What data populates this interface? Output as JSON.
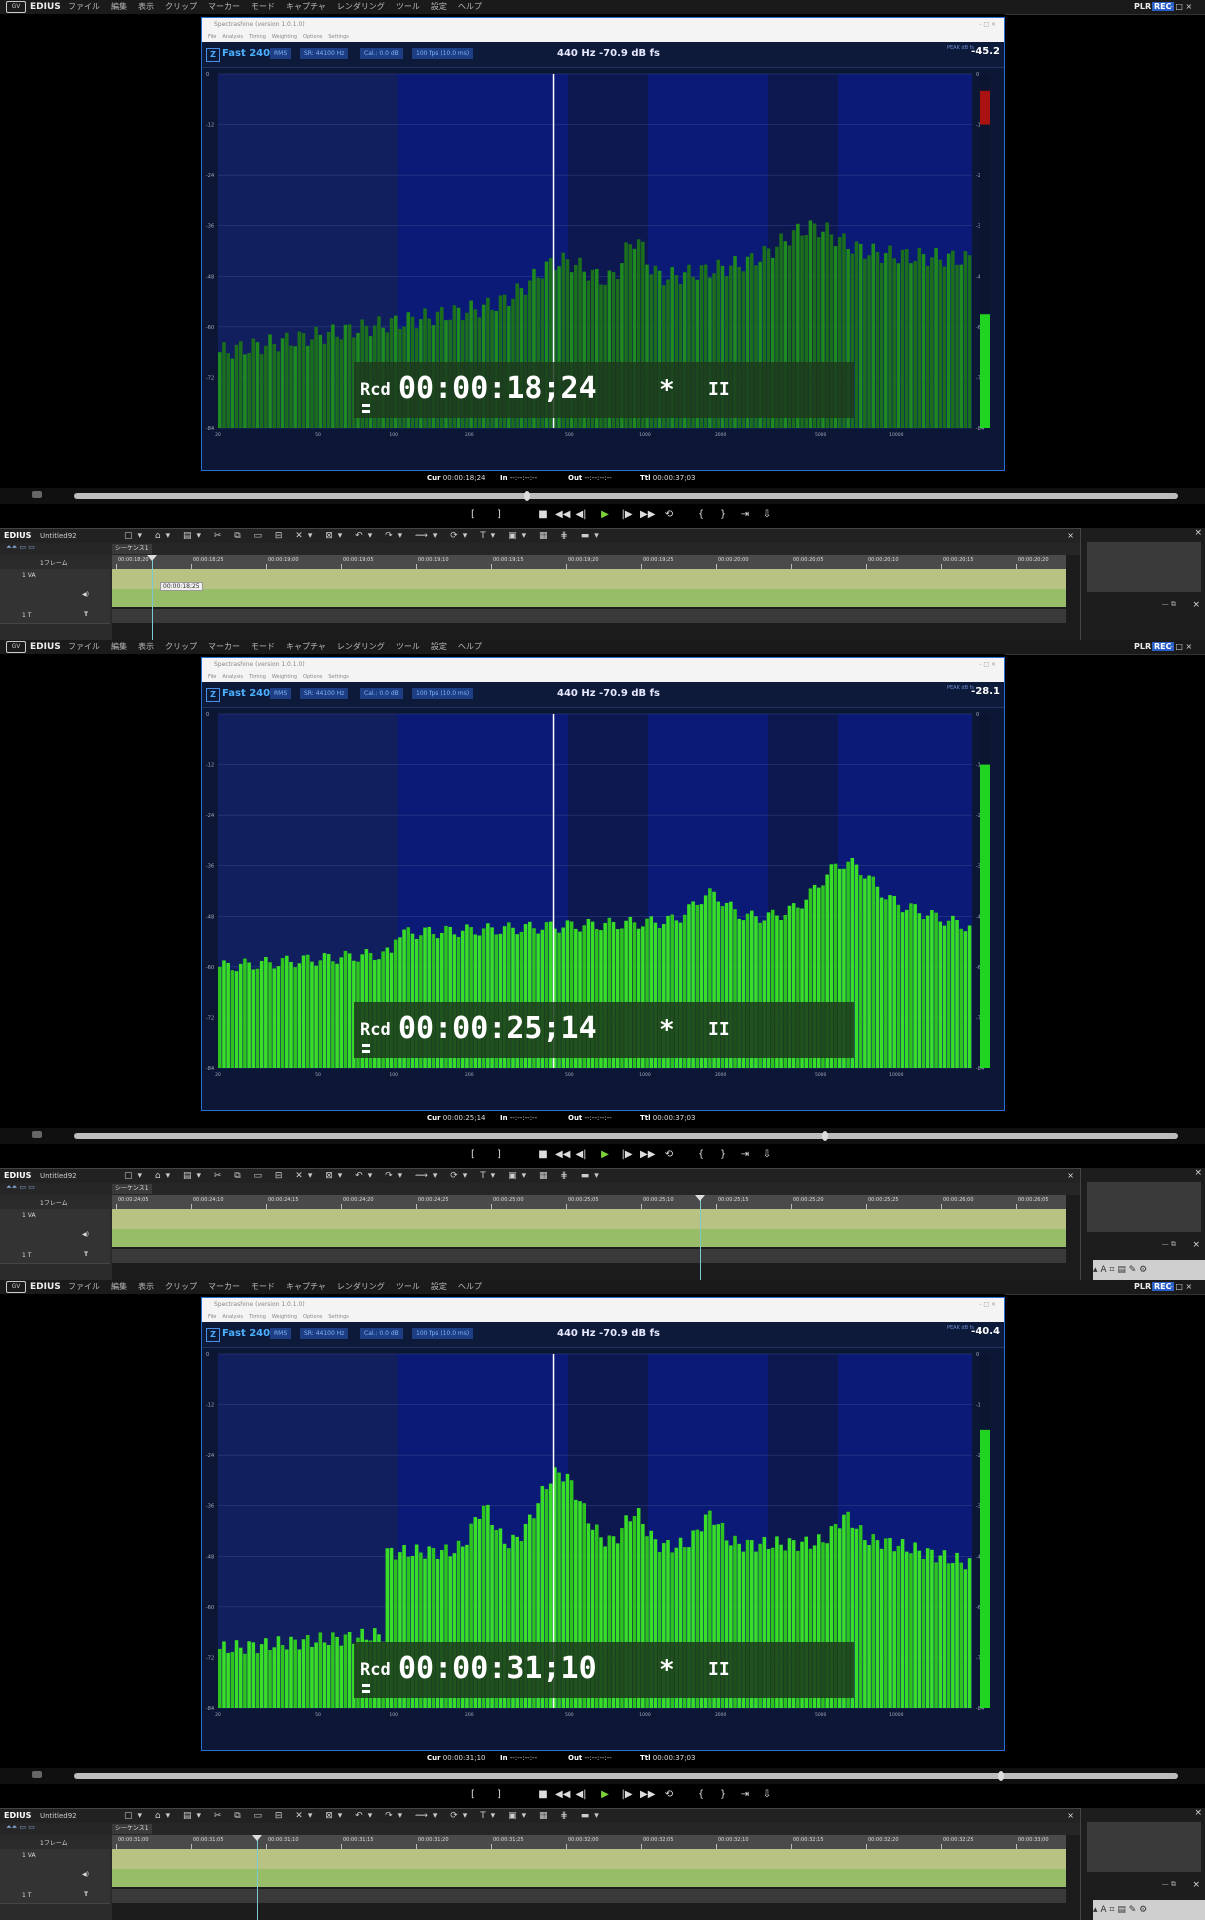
{
  "app": {
    "name": "EDIUS",
    "logo": "GV",
    "menus": [
      "ファイル",
      "編集",
      "表示",
      "クリップ",
      "マーカー",
      "モード",
      "キャプチャ",
      "レンダリング",
      "ツール",
      "設定",
      "ヘルプ"
    ],
    "mode": "PLR",
    "rec": "REC",
    "window_controls": "- □ ×"
  },
  "plugin": {
    "title": "Spectrashine (version 1.0.1.0)",
    "menu": [
      "File",
      "Analysis",
      "Timing",
      "Weighting",
      "Options",
      "Settings"
    ],
    "mode_label": "Fast 240",
    "mode_icon": "Z",
    "chips": [
      "RMS",
      "SR: 44100 Hz",
      "Cal.: 0.0 dB",
      "100 fps (10.0 ms)"
    ],
    "freq_readout": "440 Hz  -70.9 dB fs",
    "peak_label": "PEAK dB fs",
    "y_ticks": [
      "0",
      "-12",
      "-24",
      "-36",
      "-48",
      "-60",
      "-72",
      "-84"
    ],
    "x_ticks": [
      "20",
      "50",
      "100",
      "200",
      "500",
      "1000",
      "2000",
      "5000",
      "10000"
    ],
    "title_buttons": "- □ ×"
  },
  "frames": [
    {
      "timecode": "00:00:18;24",
      "rcd": "Rcd",
      "star": "*",
      "pause": "II",
      "peak": "-45.2",
      "cur": "00:00:18;24",
      "in": "--:--:--:--",
      "out": "--:--:--:--",
      "ttl": "00:00:37;03",
      "seek_fraction": 0.41,
      "timeline_tooltip": "00:00:18;25",
      "ruler": [
        "00:00:18;20",
        "00:00:18;25",
        "00:00:19;00",
        "00:00:19;05",
        "00:00:19;10",
        "00:00:19;15",
        "00:00:19;20",
        "00:00:19;25",
        "00:00:20;00",
        "00:00:20;05",
        "00:00:20;10",
        "00:00:20;15",
        "00:00:20;20"
      ]
    },
    {
      "timecode": "00:00:25;14",
      "rcd": "Rcd",
      "star": "*",
      "pause": "II",
      "peak": "-28.1",
      "cur": "00:00:25;14",
      "in": "--:--:--:--",
      "out": "--:--:--:--",
      "ttl": "00:00:37;03",
      "seek_fraction": 0.68,
      "timeline_tooltip": "",
      "ruler": [
        "00:00:24;05",
        "00:00:24;10",
        "00:00:24;15",
        "00:00:24;20",
        "00:00:24;25",
        "00:00:25;00",
        "00:00:25;05",
        "00:00:25;10",
        "00:00:25;15",
        "00:00:25;20",
        "00:00:25;25",
        "00:00:26;00",
        "00:00:26;05"
      ]
    },
    {
      "timecode": "00:00:31;10",
      "rcd": "Rcd",
      "star": "*",
      "pause": "II",
      "peak": "-40.4",
      "cur": "00:00:31;10",
      "in": "--:--:--:--",
      "out": "--:--:--:--",
      "ttl": "00:00:37;03",
      "seek_fraction": 0.84,
      "timeline_tooltip": "",
      "ruler": [
        "00:00:31;00",
        "00:00:31;05",
        "00:00:31;10",
        "00:00:31;15",
        "00:00:31;20",
        "00:00:31;25",
        "00:00:32;00",
        "00:00:32;05",
        "00:00:32;10",
        "00:00:32;15",
        "00:00:32;20",
        "00:00:32;25",
        "00:00:33;00"
      ]
    }
  ],
  "transport": {
    "cur_label": "Cur",
    "in_label": "In",
    "out_label": "Out",
    "ttl_label": "Ttl"
  },
  "timeline": {
    "project": "EDIUS",
    "project_name": "Untitled92",
    "sequence_tab": "シーケンス1",
    "frame_step": "1フレーム",
    "tracks": [
      "1 VA",
      "1 T"
    ]
  },
  "colors": {
    "spectrum_green": "#33dd22",
    "spectrum_dark": "#1c7a1a",
    "plot_bg": "#0a1a7a",
    "accent_blue": "#2a6fd6"
  }
}
